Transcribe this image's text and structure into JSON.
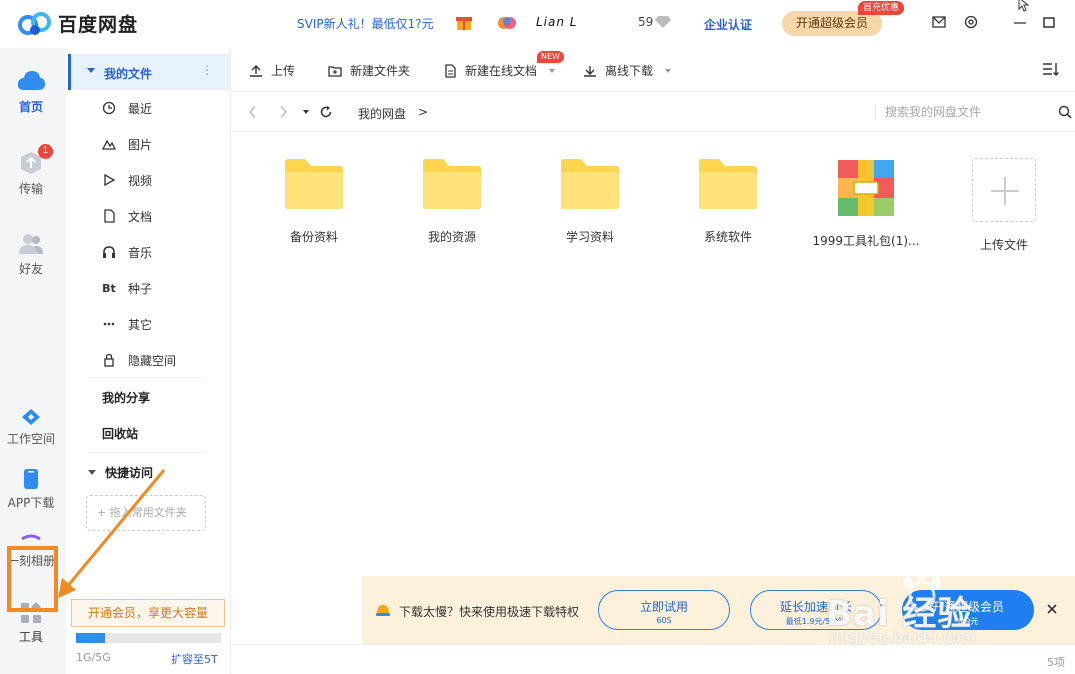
{
  "app": {
    "title": "百度网盘"
  },
  "header": {
    "promo": "SVIP新人礼！最低仅1?元",
    "username": "Lian L",
    "level": "59",
    "enterprise": "企业认证",
    "vip_button": "开通超级会员",
    "vip_badge": "首充优惠"
  },
  "rail": {
    "items": [
      {
        "label": "首页",
        "icon": "cloud-icon"
      },
      {
        "label": "传输",
        "icon": "transfer-icon",
        "badge": "1"
      },
      {
        "label": "好友",
        "icon": "friends-icon"
      },
      {
        "label": "工作空间",
        "icon": "workspace-icon"
      },
      {
        "label": "APP下载",
        "icon": "phone-icon"
      },
      {
        "label": "一刻相册",
        "icon": "album-icon"
      },
      {
        "label": "工具",
        "icon": "tools-icon"
      }
    ]
  },
  "sidebar": {
    "my_files": "我的文件",
    "items": [
      {
        "label": "最近",
        "icon": "clock-icon"
      },
      {
        "label": "图片",
        "icon": "image-icon"
      },
      {
        "label": "视频",
        "icon": "play-icon"
      },
      {
        "label": "文档",
        "icon": "document-icon"
      },
      {
        "label": "音乐",
        "icon": "headphones-icon"
      },
      {
        "label": "种子",
        "icon": "Bt"
      },
      {
        "label": "其它",
        "icon": "more-icon"
      },
      {
        "label": "隐藏空间",
        "icon": "lock-icon"
      }
    ],
    "my_share": "我的分享",
    "recycle": "回收站",
    "quick_access": "快捷访问",
    "drop_hint": "+ 拖入常用文件夹",
    "member_promo": "开通会员，享更大容量",
    "quota_used": "1G/5G",
    "quota_fraction": 0.2,
    "expand": "扩容至5T"
  },
  "toolbar": {
    "upload": "上传",
    "new_folder": "新建文件夹",
    "new_online_doc": "新建在线文档",
    "new_badge": "NEW",
    "offline_download": "离线下载"
  },
  "nav": {
    "breadcrumb": "我的网盘",
    "separator": ">",
    "search_placeholder": "搜索我的网盘文件"
  },
  "files": [
    {
      "name": "备份资料",
      "type": "folder"
    },
    {
      "name": "我的资源",
      "type": "folder"
    },
    {
      "name": "学习资料",
      "type": "folder"
    },
    {
      "name": "系统软件",
      "type": "folder"
    },
    {
      "name": "1999工具礼包(1)...",
      "type": "archive"
    },
    {
      "name": "上传文件",
      "type": "upload"
    }
  ],
  "banner": {
    "text": "下载太慢？快来使用极速下载特权",
    "try_now": "立即试用",
    "try_sub": "60S",
    "extend": "延长加速时长",
    "extend_sub": "最低1.9元/5分钟",
    "open": "开通超级会员",
    "open_sub": "8.9元"
  },
  "watermark": {
    "brand": "Bai 经验",
    "url": "jingyan.baidu.com"
  },
  "status": {
    "count": "5项"
  },
  "colors": {
    "accent": "#2563d8",
    "folder": "#ffd54f",
    "highlight": "#f28a24"
  }
}
